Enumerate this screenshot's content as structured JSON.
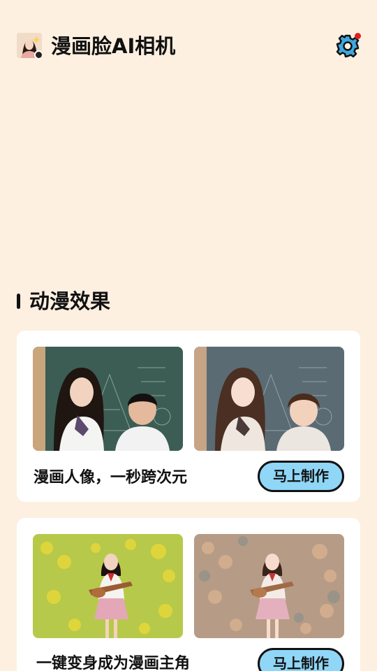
{
  "header": {
    "title": "漫画脸AI相机",
    "settings_icon": "gear-icon",
    "accent_color": "#0f6fb0",
    "notification_dot_color": "#e02020"
  },
  "section": {
    "title": "动漫效果"
  },
  "cards": [
    {
      "caption": "漫画人像，一秒跨次元",
      "button_label": "马上制作"
    },
    {
      "caption": "一键变身成为漫画主角",
      "button_label": "马上制作"
    }
  ],
  "colors": {
    "background": "#fdf0e1",
    "button_fill": "#8fd6f7"
  }
}
